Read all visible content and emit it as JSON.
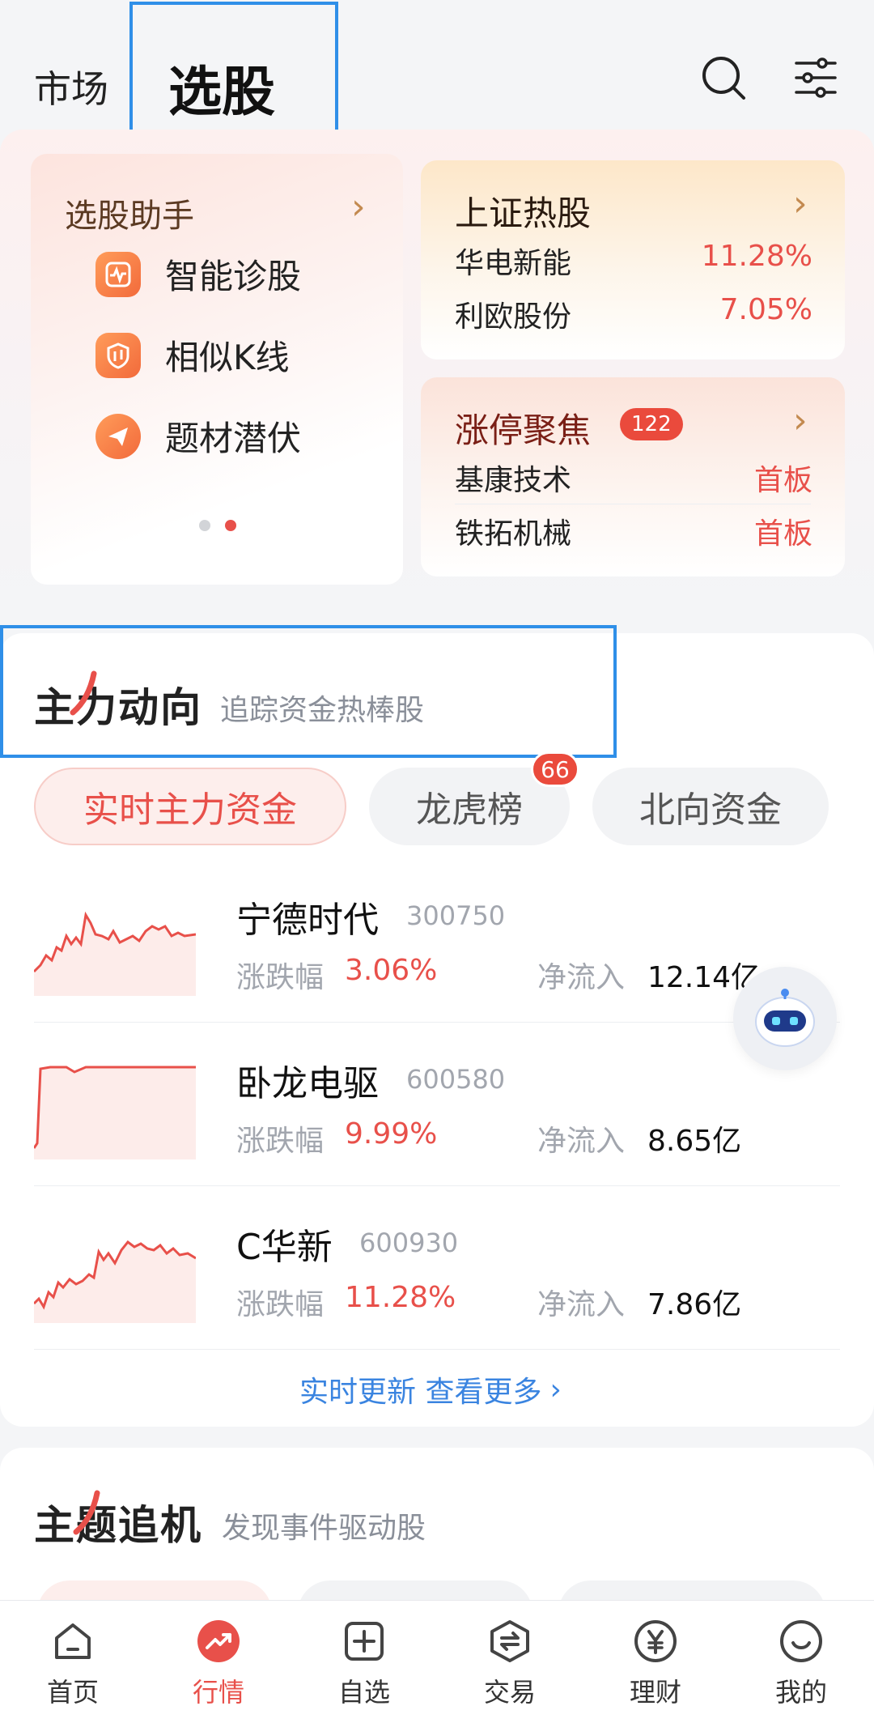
{
  "header": {
    "tab_market": "市场",
    "tab_select": "选股"
  },
  "assistant": {
    "title": "选股助手",
    "items": [
      {
        "label": "智能诊股",
        "icon": "diagnosis-icon"
      },
      {
        "label": "相似K线",
        "icon": "kline-shield-icon"
      },
      {
        "label": "题材潜伏",
        "icon": "theme-plane-icon"
      }
    ],
    "page_index": 2,
    "page_count": 2
  },
  "hot_stocks": {
    "title": "上证热股",
    "rows": [
      {
        "name": "华电新能",
        "value": "11.28%"
      },
      {
        "name": "利欧股份",
        "value": "7.05%"
      }
    ]
  },
  "limit_up": {
    "title": "涨停聚焦",
    "badge": "122",
    "rows": [
      {
        "name": "基康技术",
        "value": "首板"
      },
      {
        "name": "铁拓机械",
        "value": "首板"
      }
    ]
  },
  "main_flow": {
    "title": "主力动向",
    "subtitle": "追踪资金热棒股",
    "tabs": [
      {
        "label": "实时主力资金",
        "active": true
      },
      {
        "label": "龙虎榜",
        "badge": "66"
      },
      {
        "label": "北向资金"
      }
    ],
    "labels": {
      "change": "涨跌幅",
      "inflow": "净流入"
    },
    "stocks": [
      {
        "name": "宁德时代",
        "code": "300750",
        "change": "3.06%",
        "inflow": "12.14亿"
      },
      {
        "name": "卧龙电驱",
        "code": "600580",
        "change": "9.99%",
        "inflow": "8.65亿"
      },
      {
        "name": "C华新",
        "code": "600930",
        "change": "11.28%",
        "inflow": "7.86亿"
      }
    ],
    "more": "实时更新 查看更多"
  },
  "theme_chase": {
    "title": "主题追机",
    "subtitle": "发现事件驱动股"
  },
  "nav": [
    {
      "label": "首页",
      "icon": "home-icon"
    },
    {
      "label": "行情",
      "icon": "market-trend-icon",
      "active": true
    },
    {
      "label": "自选",
      "icon": "watchlist-plus-icon"
    },
    {
      "label": "交易",
      "icon": "trade-exchange-icon"
    },
    {
      "label": "理财",
      "icon": "wealth-yen-icon"
    },
    {
      "label": "我的",
      "icon": "profile-smile-icon"
    }
  ],
  "colors": {
    "accent_red": "#e8504a",
    "link_blue": "#3a84e0",
    "highlight_box": "#2f8fe8"
  }
}
